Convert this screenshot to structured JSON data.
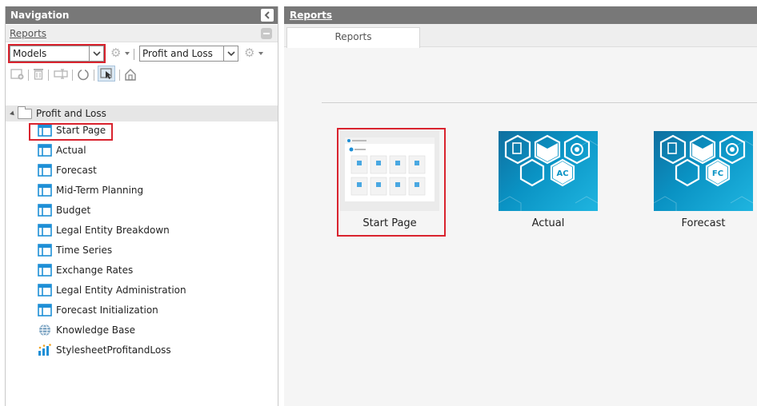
{
  "navigation": {
    "title": "Navigation",
    "section_title": "Reports",
    "model_select": "Models",
    "report_select": "Profit and Loss",
    "tree": {
      "root_label": "Profit and Loss",
      "items": [
        {
          "label": "Start Page",
          "icon": "layout-icon"
        },
        {
          "label": "Actual",
          "icon": "layout-icon"
        },
        {
          "label": "Forecast",
          "icon": "layout-icon"
        },
        {
          "label": "Mid-Term Planning",
          "icon": "layout-icon"
        },
        {
          "label": "Budget",
          "icon": "layout-icon"
        },
        {
          "label": "Legal Entity Breakdown",
          "icon": "layout-icon"
        },
        {
          "label": "Time Series",
          "icon": "layout-icon"
        },
        {
          "label": "Exchange Rates",
          "icon": "layout-icon"
        },
        {
          "label": "Legal Entity Administration",
          "icon": "layout-icon"
        },
        {
          "label": "Forecast Initialization",
          "icon": "layout-icon"
        },
        {
          "label": "Knowledge Base",
          "icon": "globe-icon"
        },
        {
          "label": "StylesheetProfitandLoss",
          "icon": "stylesheet-icon"
        }
      ]
    }
  },
  "main": {
    "title": "Reports",
    "tab_label": "Reports",
    "tiles": [
      {
        "caption": "Start Page"
      },
      {
        "caption": "Actual",
        "badge": "AC"
      },
      {
        "caption": "Forecast",
        "badge": "FC"
      }
    ]
  },
  "colors": {
    "header_bg": "#787878",
    "highlight": "#d9232e",
    "tile_blue": "#0a93c4",
    "icon_blue": "#1e8fd6"
  }
}
